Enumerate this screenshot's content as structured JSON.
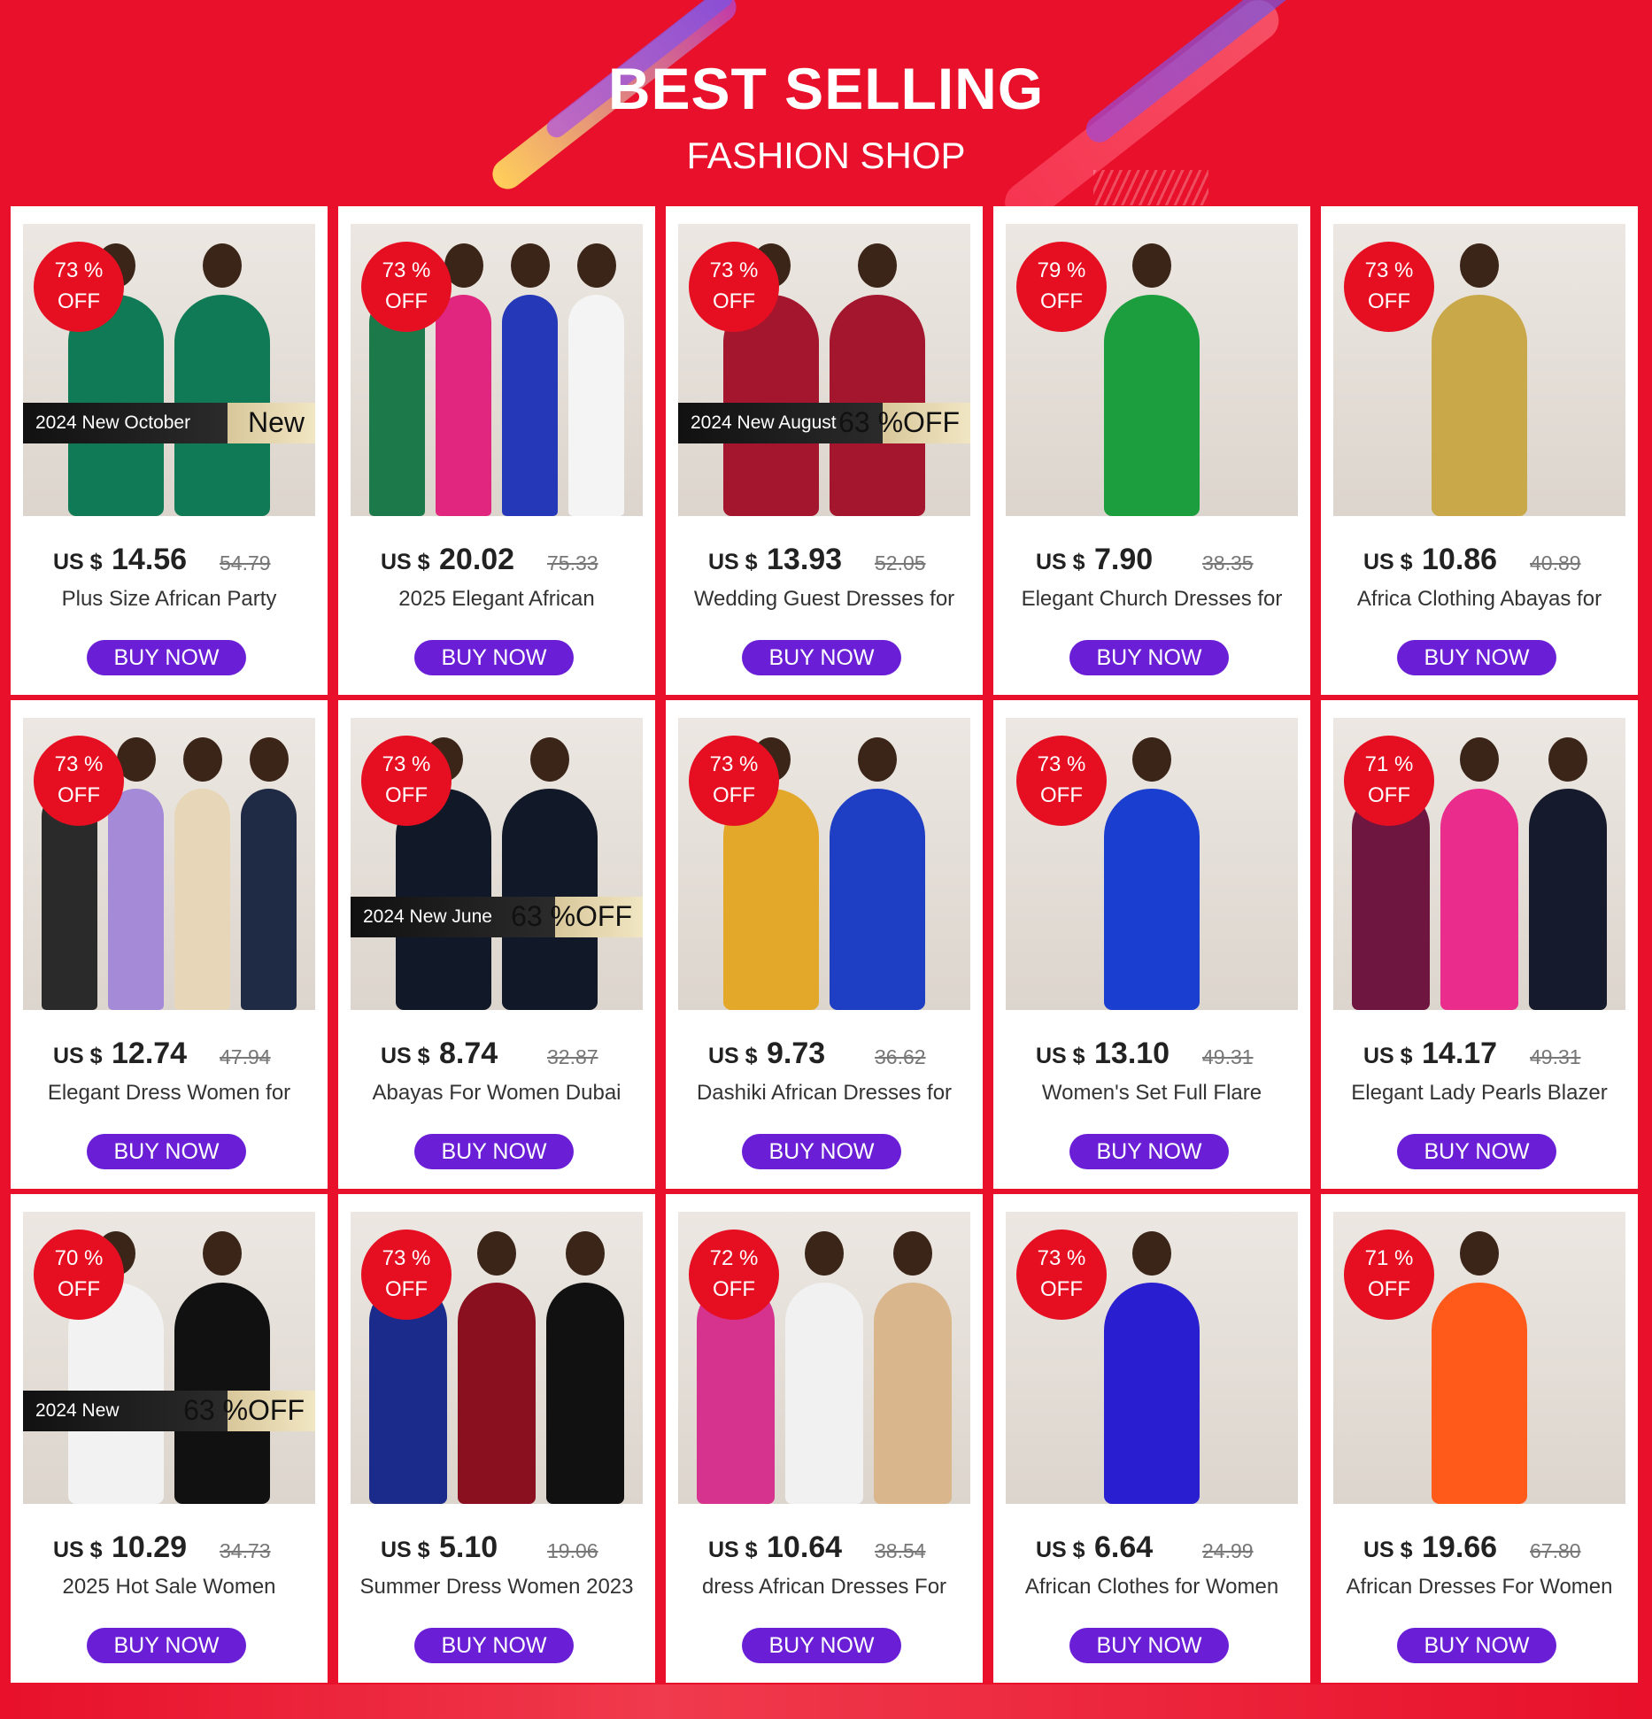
{
  "header": {
    "title": "BEST SELLING",
    "subtitle": "FASHION SHOP"
  },
  "products": [
    {
      "discount": "73 %",
      "off": "OFF",
      "currency": "US $",
      "price": "14.56",
      "old_price": "54.79",
      "name": "Plus Size African Party",
      "button": "BUY NOW",
      "banner": "2024 New October",
      "banner_tag": "New",
      "colors": [
        "#0f7a55",
        "#0f7a55"
      ]
    },
    {
      "discount": "73 %",
      "off": "OFF",
      "currency": "US $",
      "price": "20.02",
      "old_price": "75.33",
      "name": "2025 Elegant African",
      "button": "BUY NOW",
      "colors": [
        "#1c7a4a",
        "#e0267f",
        "#2438b8",
        "#f4f4f4"
      ]
    },
    {
      "discount": "73 %",
      "off": "OFF",
      "currency": "US $",
      "price": "13.93",
      "old_price": "52.05",
      "name": "Wedding Guest Dresses for",
      "button": "BUY NOW",
      "banner": "2024 New August",
      "banner_tag": "63 %OFF",
      "colors": [
        "#a3162d",
        "#a3162d"
      ]
    },
    {
      "discount": "79 %",
      "off": "OFF",
      "currency": "US $",
      "price": "7.90",
      "old_price": "38.35",
      "name": "Elegant Church Dresses for",
      "button": "BUY NOW",
      "colors": [
        "#1c9e3e"
      ]
    },
    {
      "discount": "73 %",
      "off": "OFF",
      "currency": "US $",
      "price": "10.86",
      "old_price": "40.89",
      "name": "Africa Clothing Abayas for",
      "button": "BUY NOW",
      "colors": [
        "#c9a84a"
      ]
    },
    {
      "discount": "73 %",
      "off": "OFF",
      "currency": "US $",
      "price": "12.74",
      "old_price": "47.94",
      "name": "Elegant Dress Women for",
      "button": "BUY NOW",
      "colors": [
        "#2a2a2a",
        "#a58ad8",
        "#e7d7b8",
        "#1f2a44"
      ]
    },
    {
      "discount": "73 %",
      "off": "OFF",
      "currency": "US $",
      "price": "8.74",
      "old_price": "32.87",
      "name": "Abayas For Women Dubai",
      "button": "BUY NOW",
      "banner": "2024 New June",
      "banner_tag": "63 %OFF",
      "colors": [
        "#111827",
        "#111827"
      ]
    },
    {
      "discount": "73 %",
      "off": "OFF",
      "currency": "US $",
      "price": "9.73",
      "old_price": "36.62",
      "name": "Dashiki African Dresses for",
      "button": "BUY NOW",
      "colors": [
        "#e3a72a",
        "#1e3fc4"
      ]
    },
    {
      "discount": "73 %",
      "off": "OFF",
      "currency": "US $",
      "price": "13.10",
      "old_price": "49.31",
      "name": "Women's Set Full Flare",
      "button": "BUY NOW",
      "colors": [
        "#1a3fd0"
      ]
    },
    {
      "discount": "71 %",
      "off": "OFF",
      "currency": "US $",
      "price": "14.17",
      "old_price": "49.31",
      "name": "Elegant Lady Pearls Blazer",
      "button": "BUY NOW",
      "colors": [
        "#6e1640",
        "#ea2d8c",
        "#151a2c"
      ]
    },
    {
      "discount": "70 %",
      "off": "OFF",
      "currency": "US $",
      "price": "10.29",
      "old_price": "34.73",
      "name": "2025 Hot Sale Women",
      "button": "BUY NOW",
      "banner": "2024 New",
      "banner_tag": "63 %OFF",
      "colors": [
        "#f2f2f2",
        "#111111"
      ]
    },
    {
      "discount": "73 %",
      "off": "OFF",
      "currency": "US $",
      "price": "5.10",
      "old_price": "19.06",
      "name": "Summer Dress Women 2023",
      "button": "BUY NOW",
      "colors": [
        "#1b2b8c",
        "#8a0f1f",
        "#111111"
      ]
    },
    {
      "discount": "72 %",
      "off": "OFF",
      "currency": "US $",
      "price": "10.64",
      "old_price": "38.54",
      "name": "dress African Dresses For",
      "button": "BUY NOW",
      "colors": [
        "#d6338f",
        "#f1f1f1",
        "#d9b68c"
      ]
    },
    {
      "discount": "73 %",
      "off": "OFF",
      "currency": "US $",
      "price": "6.64",
      "old_price": "24.99",
      "name": "African Clothes for Women",
      "button": "BUY NOW",
      "colors": [
        "#2a1ed1"
      ]
    },
    {
      "discount": "71 %",
      "off": "OFF",
      "currency": "US $",
      "price": "19.66",
      "old_price": "67.80",
      "name": "African Dresses For Women",
      "button": "BUY NOW",
      "colors": [
        "#ff5a1a"
      ]
    }
  ]
}
